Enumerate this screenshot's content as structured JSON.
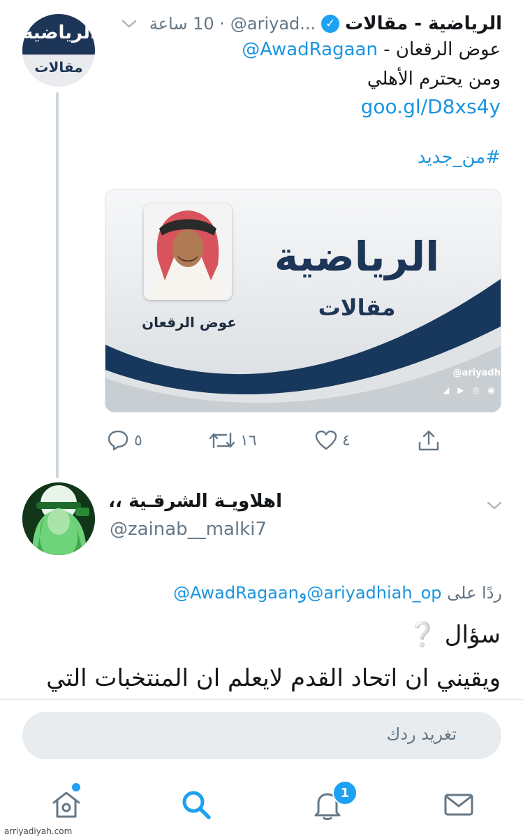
{
  "tweet1": {
    "avatar_logo": "الرياضية",
    "avatar_sub": "مقالات",
    "name": "الرياضية - مقالات",
    "handle": "@ariyad...",
    "time": "· 10 ساعة",
    "line1_text": "عوض الرقعان - ",
    "line1_mention": "@AwadRagaan",
    "line2": "ومن يحترم الأهلي",
    "link": "goo.gl/D8xs4y",
    "hashtag": "#من_جديد",
    "card": {
      "author": "عوض الرقعان",
      "logo": "الرياضية",
      "sub": "مقالات",
      "handle": "@ariyadh"
    },
    "actions": {
      "reply_count": "٥",
      "retweet_count": "١٦",
      "like_count": "٤"
    }
  },
  "tweet2": {
    "name": "اهلاويـة الشرقـية ،،",
    "handle": "@zainab__malki7",
    "reply_prefix": "ردًا على",
    "reply_mention1": "@ariyadhiah_op",
    "reply_and": "و",
    "reply_mention2": "@AwadRagaan",
    "line1": "سؤال ❔",
    "line2": "ويقيني ان اتحاد القدم لايعلم ان المنتخبات التي"
  },
  "compose": {
    "placeholder": "تغريد ردك"
  },
  "tabbar": {
    "notification_badge": "1",
    "icons": [
      "home-icon",
      "search-icon",
      "notifications-icon",
      "messages-icon"
    ]
  },
  "watermark": "arriyadiyah.com",
  "colors": {
    "accent": "#1da1f2",
    "link": "#1b95e0",
    "brand_navy": "#1d3557"
  }
}
